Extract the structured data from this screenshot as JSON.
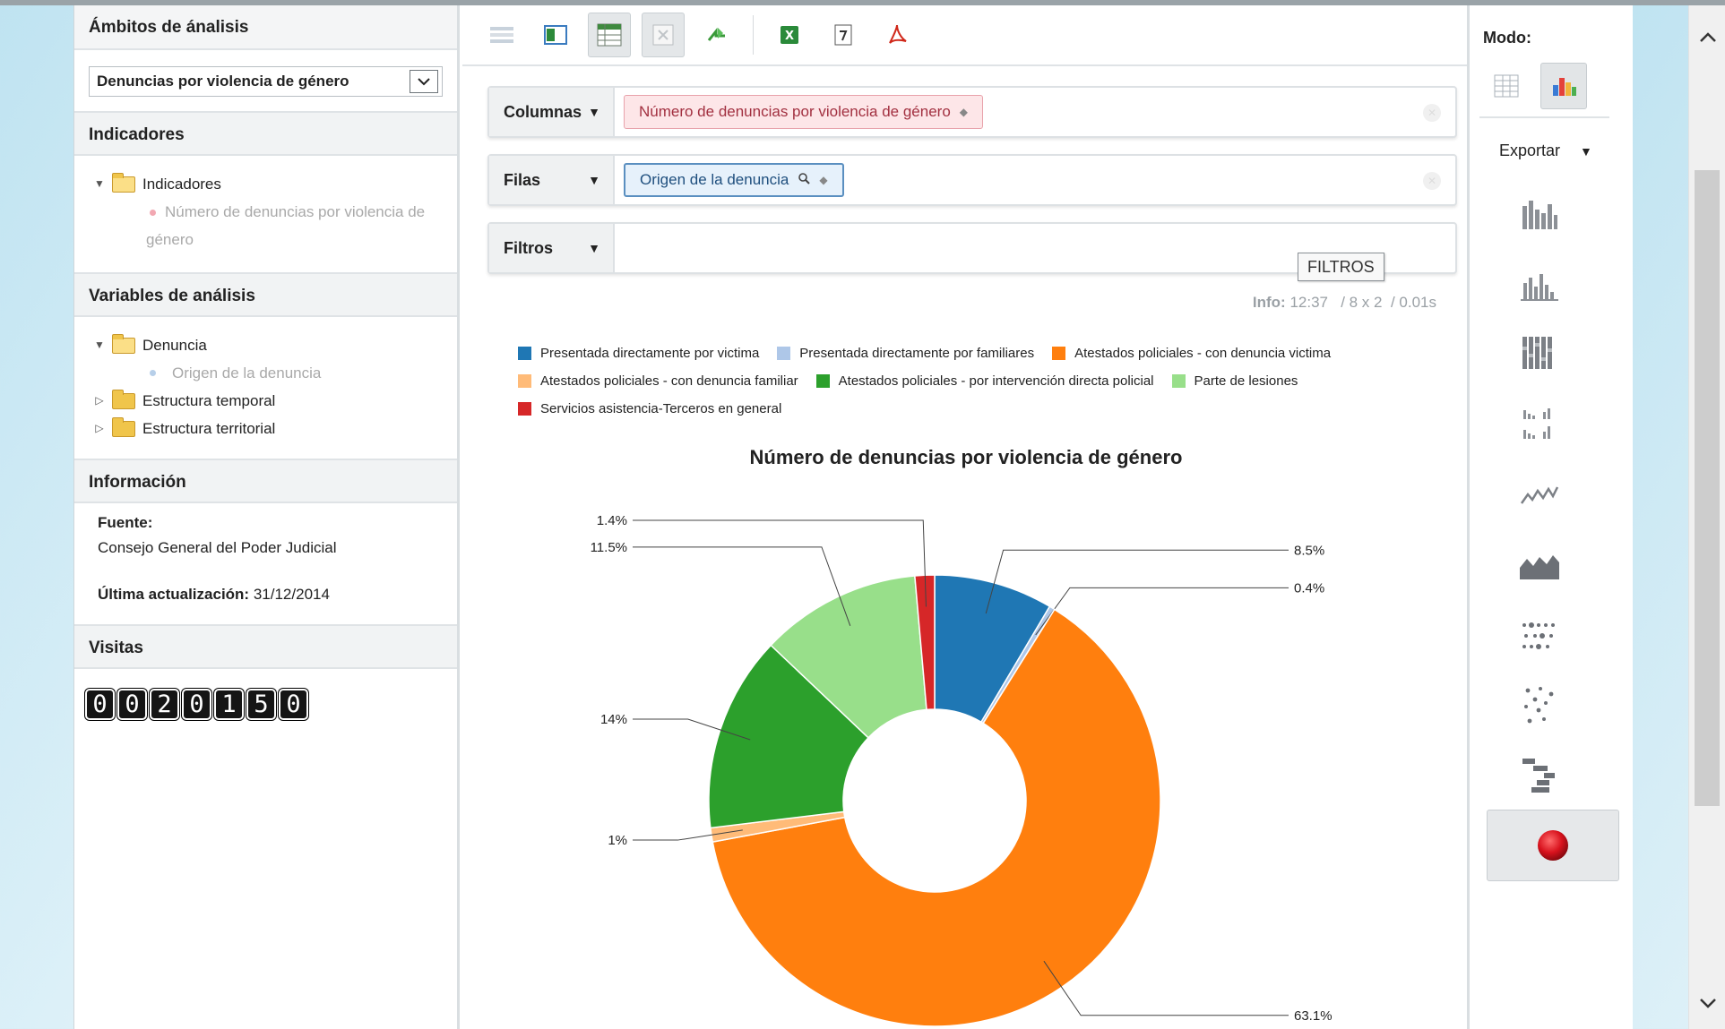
{
  "sidebar": {
    "ambitos_title": "Ámbitos de ánalisis",
    "ambito_selected": "Denuncias por violencia de género",
    "indicadores_title": "Indicadores",
    "indicadores_folder": "Indicadores",
    "indicador_leaf": "Número de denuncias por violencia de género",
    "variables_title": "Variables de análisis",
    "variables_folder": "Denuncia",
    "variable_leaf": "Origen de la denuncia",
    "folder_temporal": "Estructura temporal",
    "folder_territorial": "Estructura territorial",
    "informacion_title": "Información",
    "fuente_label": "Fuente:",
    "fuente_value": "Consejo General del Poder Judicial",
    "actualizacion_label": "Última actualización:",
    "actualizacion_value": "31/12/2014",
    "visitas_title": "Visitas",
    "visitas_digits": [
      "0",
      "0",
      "2",
      "0",
      "1",
      "5",
      "0"
    ]
  },
  "shelves": {
    "columnas_label": "Columnas",
    "columnas_pill": "Número de denuncias por violencia de género",
    "filas_label": "Filas",
    "filas_pill": "Origen de la denuncia",
    "filtros_label": "Filtros",
    "filtros_tooltip": "FILTROS"
  },
  "info": {
    "label": "Info:",
    "time": "12:37",
    "dims": "/ 8 x 2",
    "duration": "/ 0.01s"
  },
  "right_panel": {
    "modo_label": "Modo:",
    "exportar_label": "Exportar"
  },
  "colors": {
    "accent_red_pill": "#fde6e8",
    "accent_blue_pill": "#e6f1fb"
  },
  "chart_data": {
    "type": "pie",
    "title": "Número de denuncias por violencia de género",
    "donut": true,
    "legend_position": "top",
    "slices": [
      {
        "name": "Presentada directamente por victima",
        "value": 8.5,
        "label": "8.5%",
        "color": "#1f77b4"
      },
      {
        "name": "Presentada directamente por familiares",
        "value": 0.4,
        "label": "0.4%",
        "color": "#aec7e8"
      },
      {
        "name": "Atestados policiales - con denuncia victima",
        "value": 63.1,
        "label": "63.1%",
        "color": "#ff7f0e"
      },
      {
        "name": "Atestados policiales - con denuncia familiar",
        "value": 1.0,
        "label": "1%",
        "color": "#ffbb78"
      },
      {
        "name": "Atestados policiales - por intervención directa policial",
        "value": 14.0,
        "label": "14%",
        "color": "#2ca02c"
      },
      {
        "name": "Parte de lesiones",
        "value": 11.5,
        "label": "11.5%",
        "color": "#98df8a"
      },
      {
        "name": "Servicios asistencia-Terceros en general",
        "value": 1.4,
        "label": "1.4%",
        "color": "#d62728"
      }
    ]
  }
}
